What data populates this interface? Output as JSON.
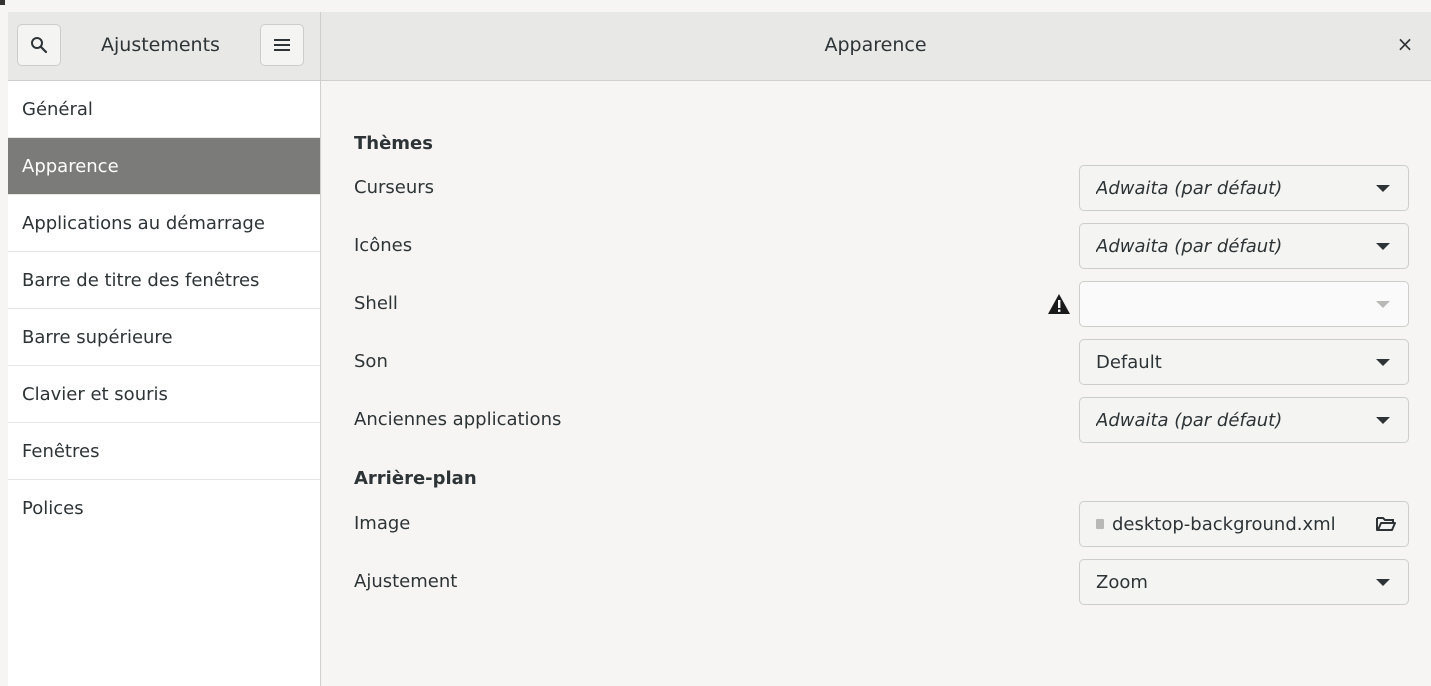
{
  "header": {
    "app_title": "Ajustements",
    "page_title": "Apparence",
    "close_label": "×",
    "search_icon": "search-icon",
    "menu_icon": "hamburger-menu-icon"
  },
  "sidebar": {
    "items": [
      {
        "label": "Général"
      },
      {
        "label": "Apparence",
        "selected": true
      },
      {
        "label": "Applications au démarrage"
      },
      {
        "label": "Barre de titre des fenêtres"
      },
      {
        "label": "Barre supérieure"
      },
      {
        "label": "Clavier et souris"
      },
      {
        "label": "Fenêtres"
      },
      {
        "label": "Polices"
      }
    ]
  },
  "themes": {
    "title": "Thèmes",
    "cursors": {
      "label": "Curseurs",
      "value": "Adwaita (par défaut)"
    },
    "icons": {
      "label": "Icônes",
      "value": "Adwaita (par défaut)"
    },
    "shell": {
      "label": "Shell",
      "value": "",
      "warning_icon": "warning-icon"
    },
    "sound": {
      "label": "Son",
      "value": "Default"
    },
    "legacy": {
      "label": "Anciennes applications",
      "value": "Adwaita (par défaut)"
    }
  },
  "background": {
    "title": "Arrière-plan",
    "image": {
      "label": "Image",
      "value": "desktop-background.xml",
      "icon": "folder-open-icon"
    },
    "adjustment": {
      "label": "Ajustement",
      "value": "Zoom"
    }
  },
  "colors": {
    "selected_bg": "#7b7b7a",
    "header_bg": "#e8e8e7",
    "window_bg": "#f6f5f4"
  }
}
